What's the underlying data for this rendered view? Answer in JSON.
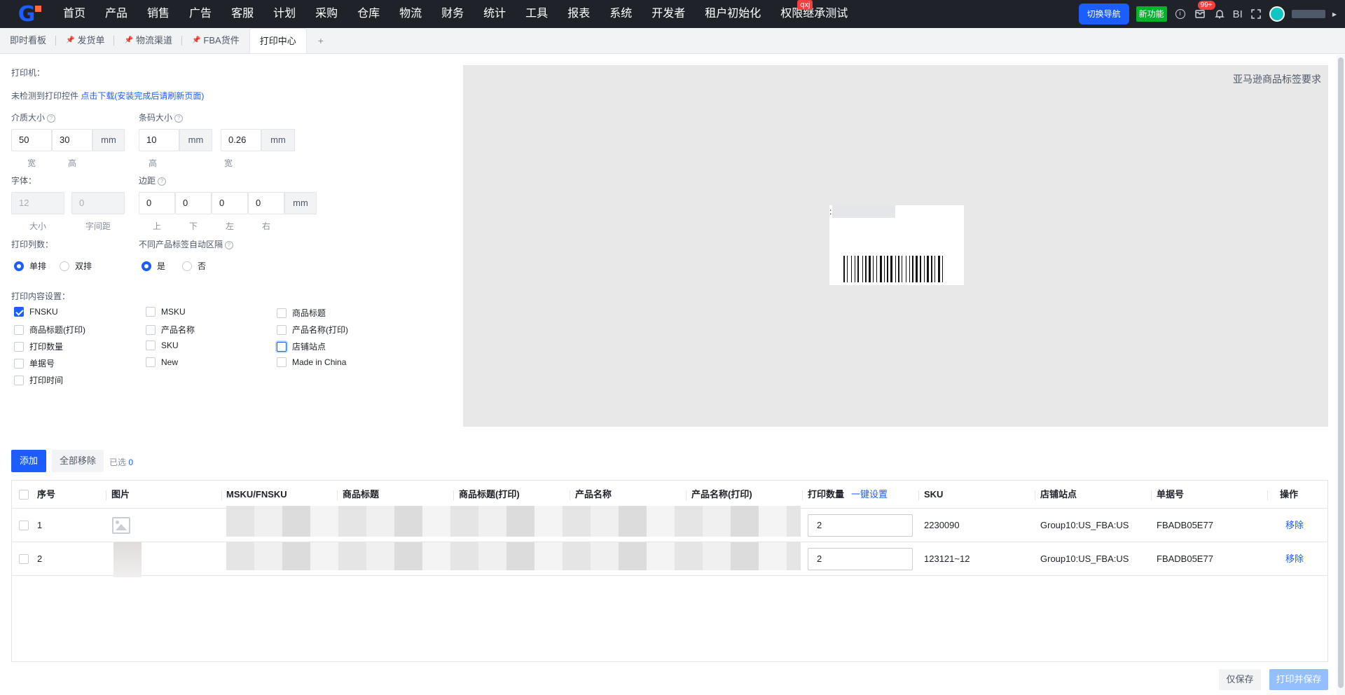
{
  "nav": {
    "menu": [
      "首页",
      "产品",
      "销售",
      "广告",
      "客服",
      "计划",
      "采购",
      "仓库",
      "物流",
      "财务",
      "统计",
      "工具",
      "报表",
      "系统",
      "开发者",
      "租户初始化",
      "权限继承测试"
    ],
    "menu_badge": "qxj",
    "switch_label": "切换导航",
    "new_feature_label": "新功能",
    "msg_badge": "99+",
    "bi_label": "BI"
  },
  "tabs": [
    {
      "label": "即时看板",
      "pinned": false
    },
    {
      "label": "发货单",
      "pinned": true
    },
    {
      "label": "物流渠道",
      "pinned": true
    },
    {
      "label": "FBA货件",
      "pinned": true
    },
    {
      "label": "打印中心",
      "pinned": false,
      "active": true
    }
  ],
  "tab_add": "+",
  "form": {
    "printer_label": "打印机：",
    "no_plugin_text": "未检测到打印控件",
    "download_link": "点击下载(安装完成后请刷新页面)",
    "media_size_label": "介质大小",
    "media_width": "50",
    "media_height": "30",
    "media_unit": "mm",
    "media_width_label": "宽",
    "media_height_label": "高",
    "barcode_size_label": "条码大小",
    "barcode_height": "10",
    "barcode_height_unit": "mm",
    "barcode_width": "0.26",
    "barcode_width_unit": "mm",
    "barcode_height_label": "高",
    "barcode_width_label": "宽",
    "font_label": "字体：",
    "font_size": "12",
    "font_spacing": "0",
    "font_size_label": "大小",
    "font_spacing_label": "字间距",
    "margin_label": "边距",
    "margin_top": "0",
    "margin_bottom": "0",
    "margin_left": "0",
    "margin_right": "0",
    "margin_unit": "mm",
    "margin_top_label": "上",
    "margin_bottom_label": "下",
    "margin_left_label": "左",
    "margin_right_label": "右",
    "columns_label": "打印列数：",
    "single_label": "单排",
    "double_label": "双排",
    "auto_gap_label": "不同产品标签自动区隔",
    "yes_label": "是",
    "no_label": "否",
    "content_label": "打印内容设置：",
    "checkboxes": [
      {
        "label": "FNSKU",
        "checked": true
      },
      {
        "label": "MSKU",
        "checked": false
      },
      {
        "label": "商品标题",
        "checked": false
      },
      {
        "label": "商品标题(打印)",
        "checked": false
      },
      {
        "label": "产品名称",
        "checked": false
      },
      {
        "label": "产品名称(打印)",
        "checked": false
      },
      {
        "label": "打印数量",
        "checked": false
      },
      {
        "label": "SKU",
        "checked": false
      },
      {
        "label": "店铺站点",
        "checked": false
      },
      {
        "label": "单据号",
        "checked": false
      },
      {
        "label": "New",
        "checked": false
      },
      {
        "label": "Made in China",
        "checked": false
      },
      {
        "label": "打印时间",
        "checked": false
      }
    ]
  },
  "preview": {
    "title": "亚马逊商品标签要求",
    "label_prefix": ":"
  },
  "actions": {
    "add_label": "添加",
    "remove_all_label": "全部移除",
    "selected_label": "已选",
    "selected_count": "0"
  },
  "table": {
    "headers": {
      "index": "序号",
      "image": "图片",
      "msku": "MSKU/FNSKU",
      "title": "商品标题",
      "title_print": "商品标题(打印)",
      "product_name": "产品名称",
      "product_name_print": "产品名称(打印)",
      "print_qty": "打印数量",
      "bulk_set": "一键设置",
      "sku": "SKU",
      "shop": "店铺站点",
      "doc_no": "单据号",
      "op": "操作"
    },
    "rows": [
      {
        "index": "1",
        "qty": "2",
        "sku": "2230090",
        "shop": "Group10:US_FBA:US",
        "doc_no": "FBADB05E77",
        "op": "移除"
      },
      {
        "index": "2",
        "qty": "2",
        "sku": "123121~12",
        "shop": "Group10:US_FBA:US",
        "doc_no": "FBADB05E77",
        "op": "移除"
      }
    ]
  },
  "footer": {
    "save_label": "仅保存",
    "print_save_label": "打印并保存"
  }
}
